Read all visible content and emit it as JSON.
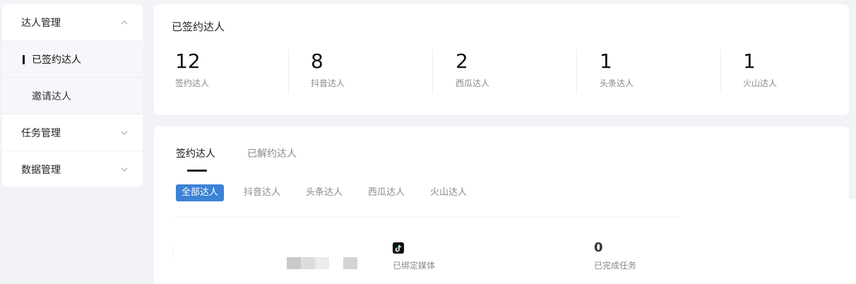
{
  "sidebar": {
    "groups": [
      {
        "label": "达人管理"
      },
      {
        "label": "任务管理"
      },
      {
        "label": "数据管理"
      }
    ],
    "subitems": [
      {
        "label": "已签约达人"
      },
      {
        "label": "邀请达人"
      }
    ]
  },
  "stats": {
    "title": "已签约达人",
    "items": [
      {
        "value": "12",
        "label": "签约达人"
      },
      {
        "value": "8",
        "label": "抖音达人"
      },
      {
        "value": "2",
        "label": "西瓜达人"
      },
      {
        "value": "1",
        "label": "头条达人"
      },
      {
        "value": "1",
        "label": "火山达人"
      }
    ]
  },
  "tabs": [
    {
      "label": "签约达人"
    },
    {
      "label": "已解约达人"
    }
  ],
  "filters": [
    {
      "label": "全部达人"
    },
    {
      "label": "抖音达人"
    },
    {
      "label": "头条达人"
    },
    {
      "label": "西瓜达人"
    },
    {
      "label": "火山达人"
    }
  ],
  "row": {
    "media_icon": "tiktok-icon",
    "media_label": "已绑定媒体",
    "tasks_value": "0",
    "tasks_label": "已完成任务"
  },
  "colors": {
    "accent": "#3b82d6",
    "background": "#f2f3f7"
  }
}
